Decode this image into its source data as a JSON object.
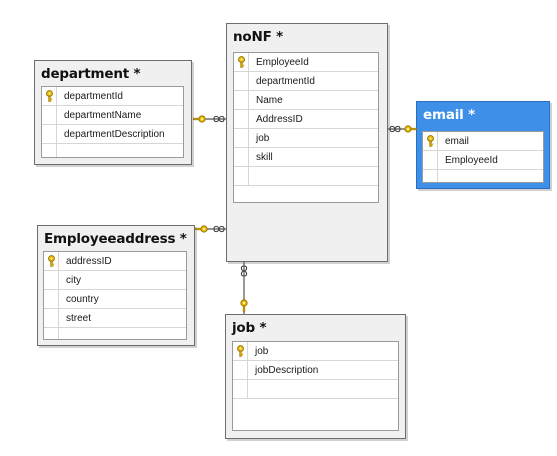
{
  "tables": {
    "department": {
      "title": "department *",
      "columns": [
        "departmentId",
        "departmentName",
        "departmentDescription"
      ],
      "key_icon": "key-icon"
    },
    "noNF": {
      "title": "noNF *",
      "columns": [
        "EmployeeId",
        "departmentId",
        "Name",
        "AddressID",
        "job",
        "skill"
      ],
      "key_icon": "key-icon"
    },
    "email": {
      "title": "email *",
      "columns": [
        "email",
        "EmployeeId"
      ],
      "key_icon": "key-icon",
      "selected": true
    },
    "Employeeaddress": {
      "title": "Employeeaddress *",
      "columns": [
        "addressID",
        "city",
        "country",
        "street"
      ],
      "key_icon": "key-icon"
    },
    "job": {
      "title": "job *",
      "columns": [
        "job",
        "jobDescription"
      ],
      "key_icon": "key-icon"
    }
  },
  "relationships": [
    {
      "from": "department",
      "to": "noNF",
      "one_end_icon": "key-icon",
      "many_end_icon": "infinity-icon"
    },
    {
      "from": "email",
      "to": "noNF",
      "one_end_icon": "key-icon",
      "many_end_icon": "infinity-icon"
    },
    {
      "from": "Employeeaddress",
      "to": "noNF",
      "one_end_icon": "key-icon",
      "many_end_icon": "infinity-icon"
    },
    {
      "from": "job",
      "to": "noNF",
      "one_end_icon": "key-icon",
      "many_end_icon": "infinity-icon"
    }
  ],
  "colors": {
    "selection": "#3d8fe8",
    "key_gold": "#d4a300",
    "connector": "#555555"
  }
}
